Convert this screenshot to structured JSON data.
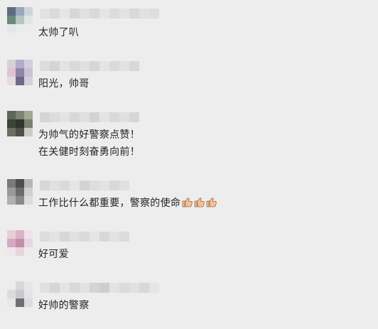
{
  "comments": [
    {
      "text": "太帅了叭",
      "avatar_colors": [
        "#5d6c7e",
        "#9aa9b9",
        "#cdd5dc",
        "#6a8b7a",
        "#b8c6c0",
        "#dfe4e6",
        "#e4e7e8",
        "#ebebec",
        "#ececec"
      ],
      "name_colors": [
        "#e2e2e2",
        "#dadada",
        "#e6e6e6",
        "#d6d6d6",
        "#e0e0e0",
        "#d9d9d9",
        "#e5e5e5",
        "#dcdcdc",
        "#e3e3e3",
        "#d8d8d8",
        "#e1e1e1",
        "#dedede"
      ]
    },
    {
      "text": "阳光，帅哥",
      "avatar_colors": [
        "#d9d0dc",
        "#b6aac8",
        "#cfd0dc",
        "#e2c2d0",
        "#8f86a5",
        "#c7c2d6",
        "#e6dbe3",
        "#6e6a85",
        "#d4cfdc"
      ],
      "name_colors": [
        "#dcdcdc",
        "#d4d4d4",
        "#e3e3e3",
        "#d9d9d9",
        "#e0e0e0",
        "#d6d6d6",
        "#e4e4e4",
        "#dadada",
        "#e1e1e1",
        "#d7d7d7"
      ]
    },
    {
      "text": "为帅气的好警察点赞！",
      "text2": "在关健时刻奋勇向前！",
      "avatar_colors": [
        "#5f6657",
        "#7d8374",
        "#a2a896",
        "#3e4338",
        "#2f342c",
        "#7b8070",
        "#6a6f63",
        "#4d5246",
        "#c9ccc2"
      ],
      "name_colors": [
        "#d5d5d5",
        "#dcdcdc",
        "#e2e2e2",
        "#d8d8d8",
        "#e0e0e0",
        "#d3d3d3",
        "#e4e4e4",
        "#d9d9d9",
        "#dfdfdf",
        "#d6d6d6"
      ]
    },
    {
      "text": "工作比什么都重要，警察的使命",
      "thumbs": [
        "thumbs-up-icon",
        "thumbs-up-icon",
        "thumbs-up-icon"
      ],
      "avatar_colors": [
        "#7a7a7a",
        "#4e4e4e",
        "#b5b5b5",
        "#9a9a9a",
        "#6b6b6b",
        "#cfcfcf",
        "#b0b0b0",
        "#8a8a8a",
        "#dcdcdc"
      ],
      "name_colors": [
        "#d7d7d7",
        "#e1e1e1",
        "#dadada",
        "#e5e5e5",
        "#d3d3d3",
        "#dedede",
        "#e3e3e3",
        "#d8d8d8",
        "#e0e0e0"
      ]
    },
    {
      "text": "好可爱",
      "avatar_colors": [
        "#e6cfd9",
        "#d9b3c8",
        "#efe2e8",
        "#d6a9c0",
        "#c48ea9",
        "#e8d5df",
        "#efe6ea",
        "#e4d6dd",
        "#ececec"
      ],
      "name_colors": [
        "#dddddd",
        "#e3e3e3",
        "#d7d7d7",
        "#e1e1e1",
        "#dadada",
        "#e5e5e5",
        "#d8d8d8",
        "#e2e2e2",
        "#dcdcdc"
      ]
    },
    {
      "text": "好帅的警察",
      "avatar_colors": [
        "#ececec",
        "#d8d8da",
        "#e6e6e8",
        "#dcdcdf",
        "#c9c9cd",
        "#e4e4e6",
        "#e8e8ea",
        "#6f6f74",
        "#dcdcde"
      ],
      "name_colors": [
        "#e0e0e0",
        "#d6d6d6",
        "#e4e4e4",
        "#d9d9d9",
        "#e2e2e2",
        "#d4d4d4",
        "#cfcfc9",
        "#e3e3e3",
        "#dbdbdb",
        "#e1e1e1",
        "#d8d8d8",
        "#e5e5e5"
      ]
    }
  ],
  "colors": {
    "background": "#ededed",
    "text": "#222222",
    "thumb": "#f2c09c"
  }
}
